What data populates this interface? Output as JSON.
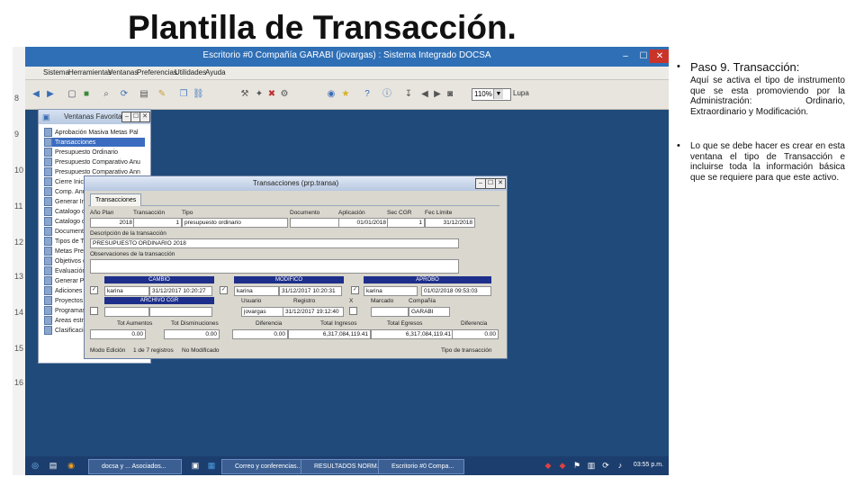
{
  "slide": {
    "title": "Plantilla de Transacción.",
    "bullet1_heading": "Paso 9. Transacción:",
    "bullet1_body": "Aquí se activa el tipo de instrumento que se esta promoviendo por la Administración: Ordinario, Extraordinario y Modificación.",
    "bullet2_body": "Lo que se debe hacer es crear en esta ventana el tipo de Transacción e incluirse toda la información básica que se requiere para que este activo.",
    "bullet_char": "•"
  },
  "app": {
    "title": "Escritorio #0 Compañía GARABI (jovargas) : Sistema Integrado DOCSA",
    "menu": [
      "Sistema",
      "Herramientas",
      "Ventanas",
      "Preferencias",
      "Utilidades",
      "Ayuda"
    ],
    "zoom": "110%",
    "lupa": "Lupa",
    "line_numbers": [
      "8",
      "9",
      "10",
      "11",
      "12",
      "13",
      "14",
      "15",
      "16"
    ],
    "window_controls": [
      "–",
      "☐",
      "✕"
    ]
  },
  "favorites": {
    "title": "Ventanas Favoritas",
    "items": [
      "Aprobación Masiva Metas Pal",
      "Transacciones",
      "Presupuesto Ordinario",
      "Presupuesto Comparativo Anu",
      "Presupuesto Comparativo Ann",
      "Cierre Inicia",
      "Comp. Anuli",
      "Generar Info",
      "Catalogo de",
      "Catalogo de",
      "Documento",
      "Tipos de Tra",
      "Metas Presu",
      "Objetivos d",
      "Evaluación",
      "Generar Pre",
      "Adiciones P",
      "Proyectos p",
      "Programas p",
      "Areas estra",
      "Clasificación"
    ]
  },
  "transaction": {
    "title": "Transacciones (prp.transa)",
    "tab": "Transacciones",
    "labels": {
      "anio": "Año Plan",
      "transaccion": "Transacción",
      "tipo": "Tipo",
      "documento": "Documento",
      "aplicacion": "Aplicación",
      "sec_cgr": "Sec CGR",
      "fec_limite": "Fec Límite",
      "descripcion": "Descripción de la transacción",
      "observaciones": "Observaciones de la transacción",
      "usuario": "Usuario",
      "registro": "Registro",
      "marcado": "Marcado",
      "compania": "Compañía",
      "x": "X"
    },
    "values": {
      "anio": "2018",
      "transaccion": "1",
      "tipo": "presupuesto ordinario",
      "aplicacion": "01/01/2018",
      "sec_cgr": "1",
      "fec_limite": "31/12/2018",
      "descripcion": "PRESUPUESTO ORDINARIO 2018"
    },
    "groups": {
      "cambio": "CAMBIO",
      "modifico": "MODIFICO",
      "aprobo": "APROBO",
      "archivo_cgr": "ARCHIVO CGR"
    },
    "users": {
      "cambio_user": "karina",
      "cambio_date": "31/12/2017 10:20:27",
      "modifico_user": "karina",
      "modifico_date": "31/12/2017 10:20:31",
      "aprobo_user": "karina",
      "aprobo_date": "01/02/2018 09:53:03",
      "registro_user": "jovargas",
      "registro_date": "31/12/2017 19:12:40",
      "compania": "GARABI"
    },
    "totals": {
      "headers": [
        "Tot Aumentos",
        "Tot Disminuciones",
        "Diferencia",
        "Total Ingresos",
        "Total Egresos",
        "Diferencia"
      ],
      "values": [
        "0.00",
        "0.00",
        "0.00",
        "6,317,084,119.41",
        "6,317,084,119.41",
        "0.00"
      ]
    },
    "status": {
      "modo": "Modo Edición",
      "registros": "1 de 7 registros",
      "modificado": "No Modificado",
      "tipo": "Tipo de transacción"
    }
  },
  "taskbar": {
    "tasks": [
      "docsa y ... Asociados...",
      "Correo y conferencias...",
      "RESULTADOS NORM...",
      "Escritorio #0 Compa..."
    ],
    "clock": "03:55 p.m."
  },
  "colors": {
    "desktop": "#1f4a79",
    "titlebar": "#2f6fb6",
    "section_header": "#1d2f8a"
  }
}
